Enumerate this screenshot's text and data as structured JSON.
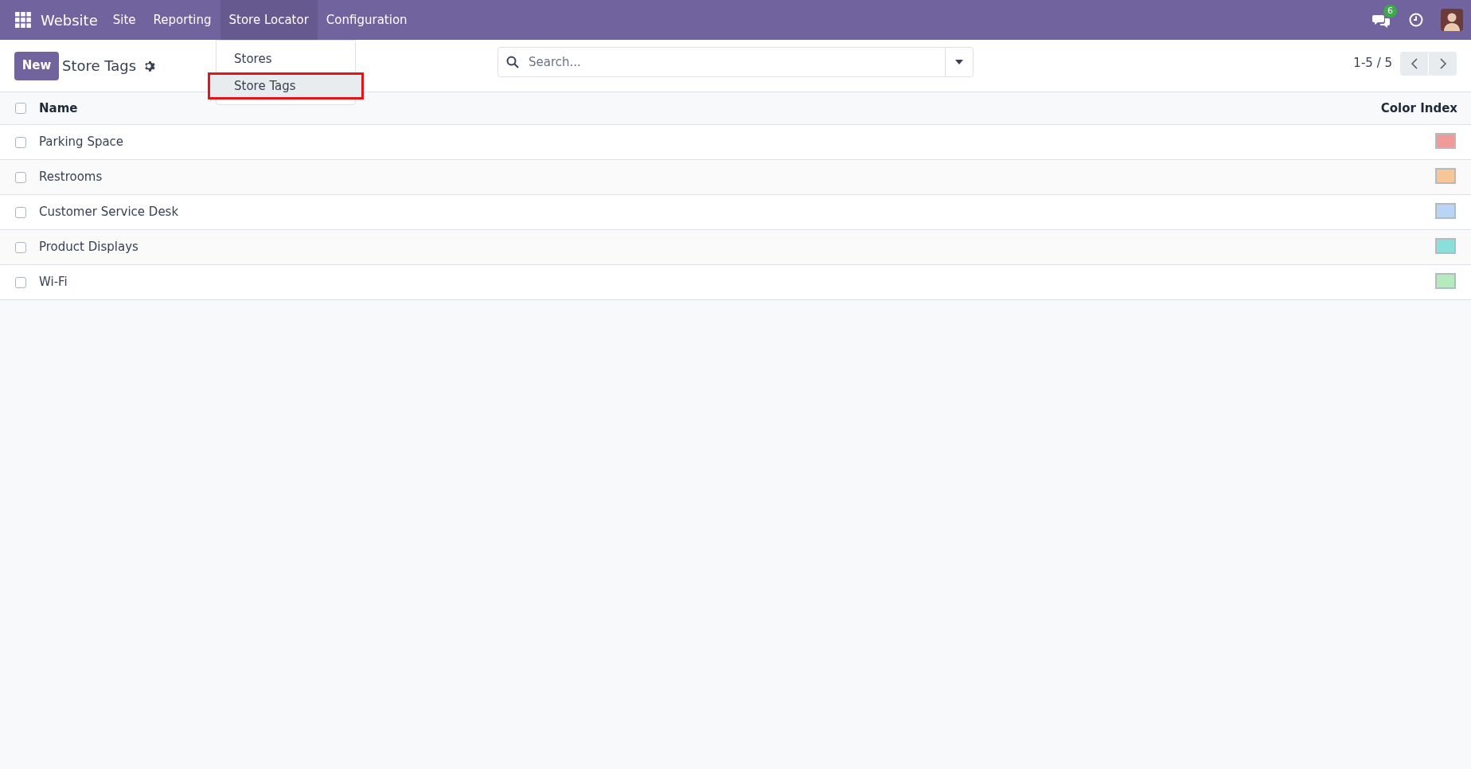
{
  "navbar": {
    "app_name": "Website",
    "menus": [
      {
        "label": "Site",
        "selected": false
      },
      {
        "label": "Reporting",
        "selected": false
      },
      {
        "label": "Store Locator",
        "selected": true
      },
      {
        "label": "Configuration",
        "selected": false
      }
    ],
    "messages_badge": "6"
  },
  "dropdown": {
    "items": [
      {
        "label": "Stores",
        "selected": false,
        "annotated": false
      },
      {
        "label": "Store Tags",
        "selected": true,
        "annotated": true
      }
    ]
  },
  "control_panel": {
    "new_button": "New",
    "title": "Store Tags",
    "search": {
      "placeholder": "Search..."
    },
    "pager": "1-5 / 5"
  },
  "table": {
    "select_all_checked": false,
    "columns": [
      "Name",
      "Color Index"
    ],
    "rows": [
      {
        "name": "Parking Space",
        "checked": false,
        "color": "#f09a9a"
      },
      {
        "name": "Restrooms",
        "checked": false,
        "color": "#f7c698"
      },
      {
        "name": "Customer Service Desk",
        "checked": false,
        "color": "#b9d5f5"
      },
      {
        "name": "Product Displays",
        "checked": false,
        "color": "#89e0da"
      },
      {
        "name": "Wi-Fi",
        "checked": false,
        "color": "#b5eabf"
      }
    ]
  }
}
